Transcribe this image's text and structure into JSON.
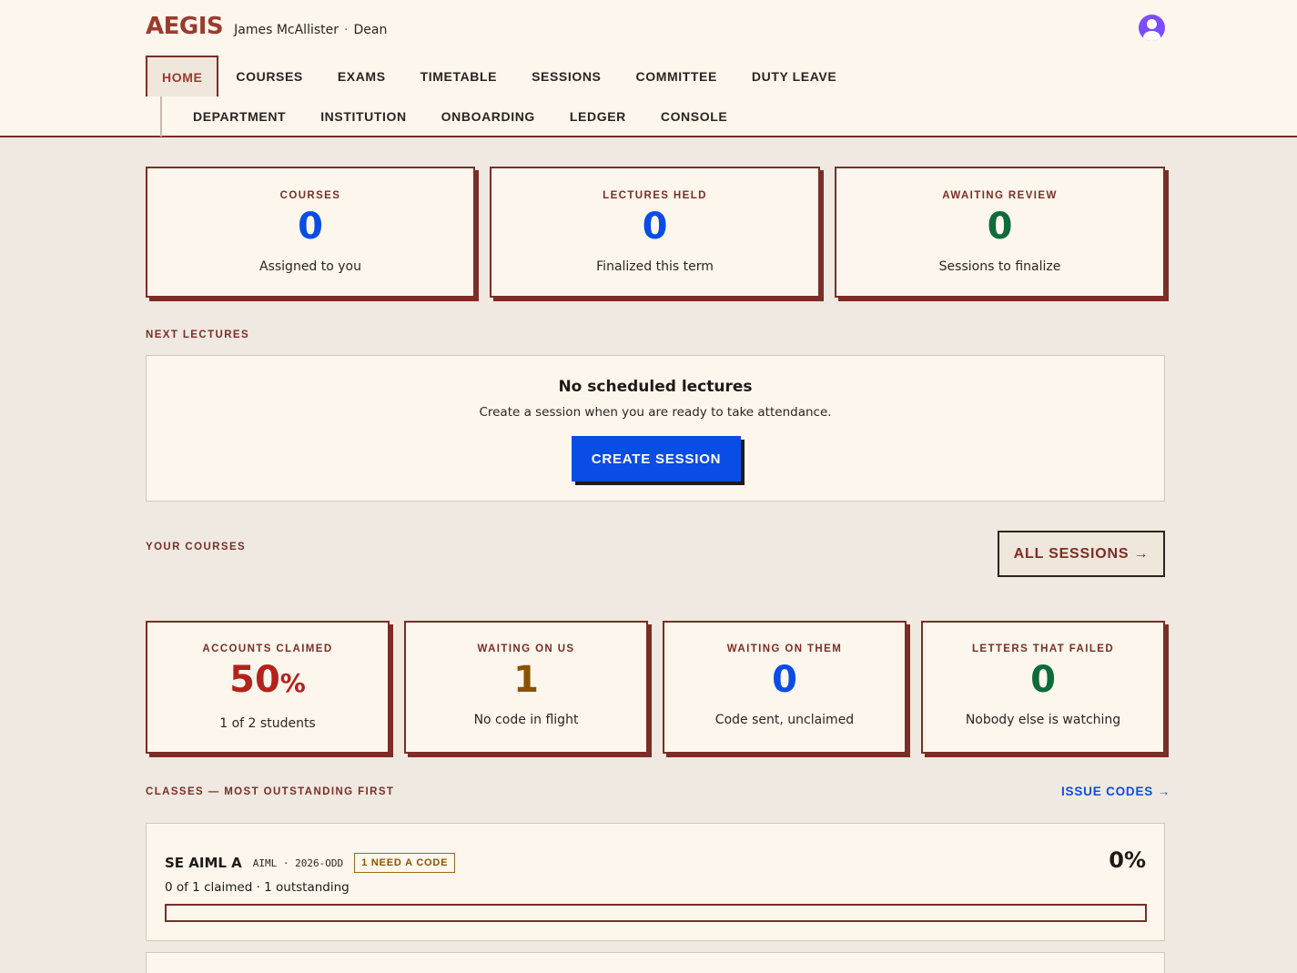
{
  "header": {
    "logo": "AEGIS",
    "user_name": "James McAllister",
    "separator": "·",
    "role": "Dean"
  },
  "nav": {
    "row1": [
      "HOME",
      "COURSES",
      "EXAMS",
      "TIMETABLE",
      "SESSIONS",
      "COMMITTEE",
      "DUTY LEAVE"
    ],
    "row2": [
      "DEPARTMENT",
      "INSTITUTION",
      "ONBOARDING",
      "LEDGER",
      "CONSOLE"
    ],
    "active": "HOME"
  },
  "stats": [
    {
      "label": "COURSES",
      "value": "0",
      "sub": "Assigned to you",
      "color": "#0a4de6"
    },
    {
      "label": "LECTURES HELD",
      "value": "0",
      "sub": "Finalized this term",
      "color": "#0a4de6"
    },
    {
      "label": "AWAITING REVIEW",
      "value": "0",
      "sub": "Sessions to finalize",
      "color": "#0e6b3a"
    }
  ],
  "next_lectures": {
    "section_label": "NEXT LECTURES",
    "empty_title": "No scheduled lectures",
    "empty_sub": "Create a session when you are ready to take attendance.",
    "button_label": "CREATE SESSION"
  },
  "your_courses": {
    "section_label": "YOUR COURSES",
    "button_label": "ALL SESSIONS →"
  },
  "accounts": [
    {
      "label": "ACCOUNTS CLAIMED",
      "value": "50",
      "unit": "%",
      "sub": "1 of 2 students",
      "color": "#b3221c"
    },
    {
      "label": "WAITING ON US",
      "value": "1",
      "sub": "No code in flight",
      "color": "#8a5200"
    },
    {
      "label": "WAITING ON THEM",
      "value": "0",
      "sub": "Code sent, unclaimed",
      "color": "#0a4de6"
    },
    {
      "label": "LETTERS THAT FAILED",
      "value": "0",
      "sub": "Nobody else is watching",
      "color": "#0e6b3a"
    }
  ],
  "classes": {
    "section_label": "CLASSES — MOST OUTSTANDING FIRST",
    "link_label": "ISSUE CODES →",
    "items": [
      {
        "name": "SE AIML A",
        "dept": "AIML",
        "dot": "·",
        "term": "2026-ODD",
        "badge": "1 NEED A CODE",
        "summary": "0 of 1 claimed · 1 outstanding",
        "percent": "0%",
        "progress": 0
      }
    ]
  }
}
